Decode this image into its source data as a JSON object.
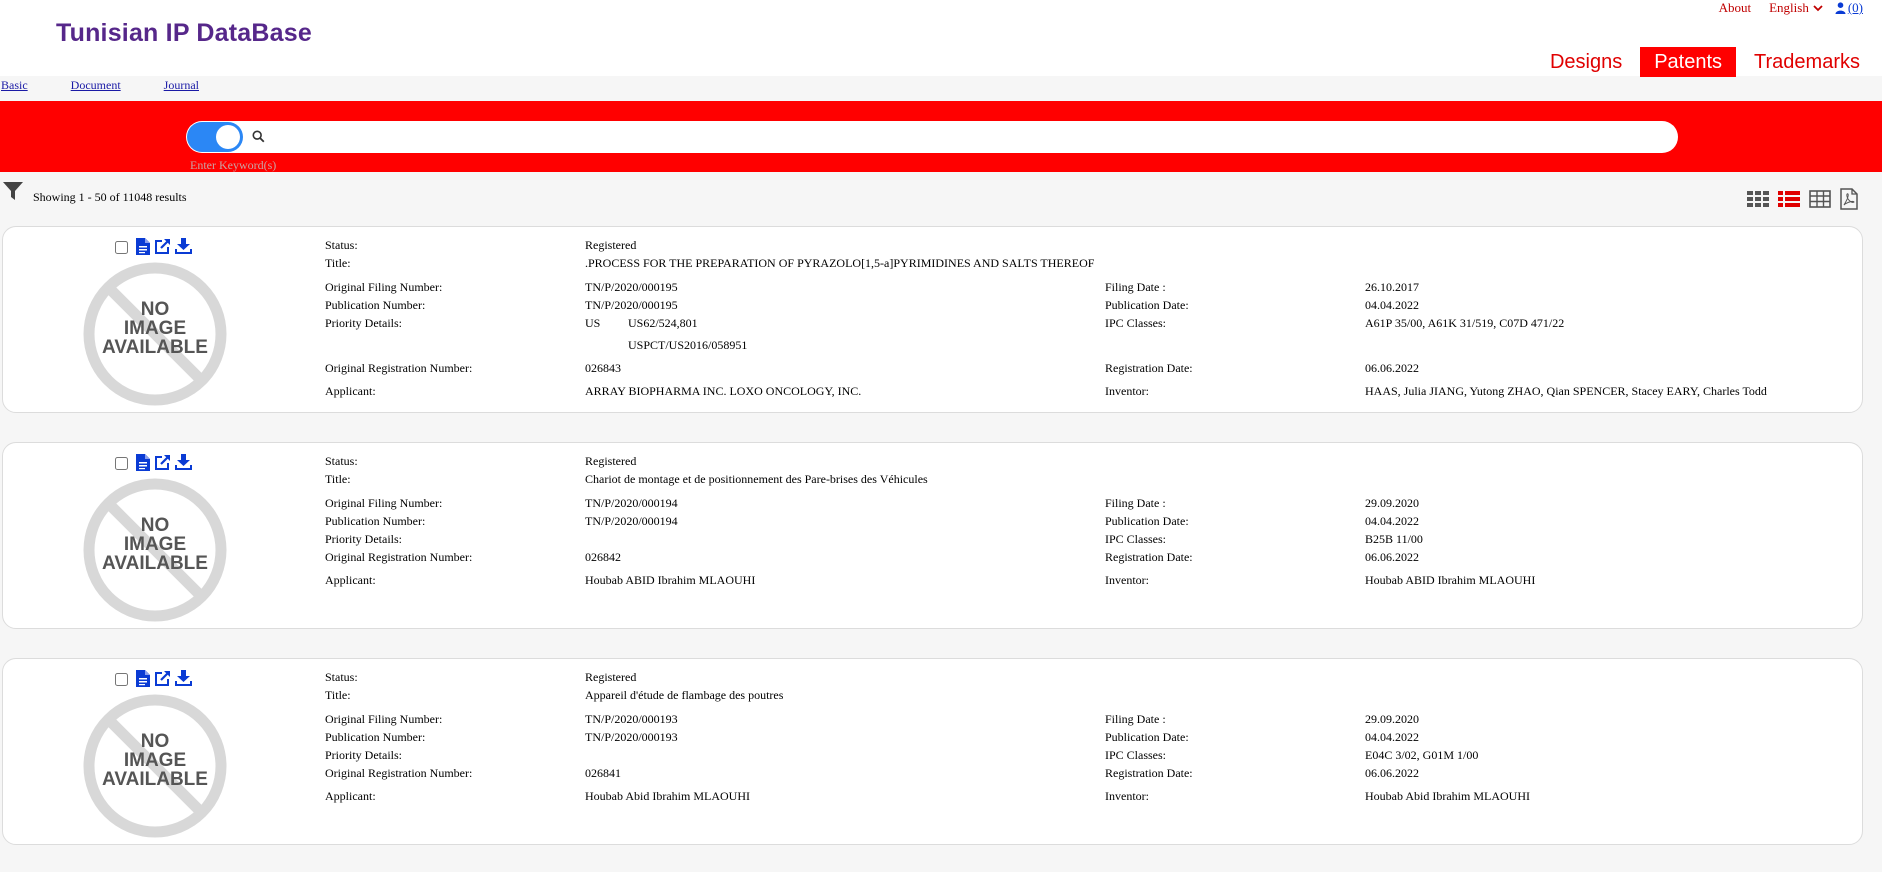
{
  "header": {
    "app_title": "Tunisian IP DataBase",
    "about": "About",
    "language": "English",
    "user_count": "(0)",
    "nav": [
      "Designs",
      "Patents",
      "Trademarks"
    ]
  },
  "search_tabs": [
    "Basic",
    "Document",
    "Journal"
  ],
  "search": {
    "placeholder": "Enter Keyword(s)",
    "value": ""
  },
  "results": {
    "count_text": "Showing 1 - 50 of 11048 results"
  },
  "labels": {
    "status": "Status:",
    "title": "Title:",
    "orig_filing": "Original Filing Number:",
    "publication_number": "Publication Number:",
    "priority": "Priority Details:",
    "orig_registration": "Original Registration Number:",
    "applicant": "Applicant:",
    "filing_date": "Filing Date :",
    "publication_date": "Publication Date:",
    "ipc": "IPC Classes:",
    "registration_date": "Registration Date:",
    "inventor": "Inventor:"
  },
  "items": [
    {
      "status": "Registered",
      "title": ".PROCESS FOR THE PREPARATION OF PYRAZOLO[1,5-a]PYRIMIDINES AND SALTS THEREOF",
      "orig_filing": "TN/P/2020/000195",
      "publication_number": "TN/P/2020/000195",
      "priority_country": "US",
      "priority_number": "US62/524,801",
      "priority_number_2": "USPCT/US2016/058951",
      "orig_registration": "026843",
      "applicant": "ARRAY BIOPHARMA INC. LOXO ONCOLOGY, INC.",
      "filing_date": "26.10.2017",
      "publication_date": "04.04.2022",
      "ipc": "A61P 35/00, A61K 31/519, C07D 471/22",
      "registration_date": "06.06.2022",
      "inventor": "HAAS, Julia JIANG, Yutong ZHAO, Qian SPENCER, Stacey EARY, Charles Todd"
    },
    {
      "status": "Registered",
      "title": "Chariot de montage et de positionnement des Pare-brises des Véhicules",
      "orig_filing": "TN/P/2020/000194",
      "publication_number": "TN/P/2020/000194",
      "orig_registration": "026842",
      "applicant": "Houbab ABID Ibrahim MLAOUHI",
      "filing_date": "29.09.2020",
      "publication_date": "04.04.2022",
      "ipc": "B25B 11/00",
      "registration_date": "06.06.2022",
      "inventor": "Houbab ABID Ibrahim MLAOUHI"
    },
    {
      "status": "Registered",
      "title": "Appareil d'étude de flambage des poutres",
      "orig_filing": "TN/P/2020/000193",
      "publication_number": "TN/P/2020/000193",
      "orig_registration": "026841",
      "applicant": "Houbab Abid Ibrahim MLAOUHI",
      "filing_date": "29.09.2020",
      "publication_date": "04.04.2022",
      "ipc": "E04C 3/02, G01M 1/00",
      "registration_date": "06.06.2022",
      "inventor": "Houbab Abid Ibrahim MLAOUHI"
    }
  ],
  "no_image_text": [
    "NO",
    "IMAGE",
    "AVAILABLE"
  ],
  "colors": {
    "brand_purple": "#56278a",
    "accent_red": "#ff0000",
    "link_blue": "#1a1aa6",
    "toggle_blue": "#2b87f5"
  },
  "icons": [
    "chevron-down-icon",
    "user-icon",
    "search-icon",
    "filter-icon",
    "grid-view-icon",
    "list-view-icon",
    "table-view-icon",
    "pdf-icon",
    "document-icon",
    "external-link-icon",
    "download-icon",
    "no-image-icon"
  ]
}
